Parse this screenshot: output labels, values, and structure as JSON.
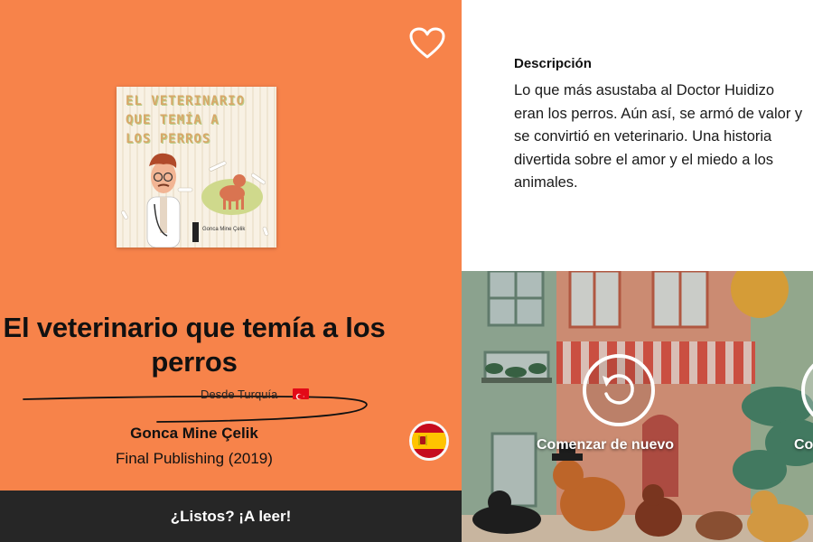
{
  "book": {
    "cover": {
      "title_lines": [
        "EL VETERINARIO",
        "QUE TEMÍA A",
        "LOS PERROS"
      ],
      "author": "Gonca Mine Çelik"
    },
    "title": "El veterinario que temía a los perros",
    "origin": "Desde Turquía",
    "author": "Gonca Mine Çelik",
    "publisher": "Final Publishing (2019)"
  },
  "icons": {
    "favorite": "heart-outline-icon",
    "origin_flag": "turkey-flag-icon",
    "language": "spain-flag-icon",
    "restart": "restart-icon"
  },
  "cta": {
    "label": "¿Listos? ¡A leer!"
  },
  "description": {
    "heading": "Descripción",
    "body": "Lo que más asustaba al Doctor Huidizo eran los perros. Aún así, se armó de valor y se convirtió en veterinario. Una historia divertida sobre el amor y el miedo a los animales."
  },
  "actions": {
    "restart_label": "Comenzar de nuevo",
    "next_label_partial": "Co"
  },
  "colors": {
    "panel": "#f7834a",
    "cta_bar": "#262626",
    "text": "#111111"
  }
}
